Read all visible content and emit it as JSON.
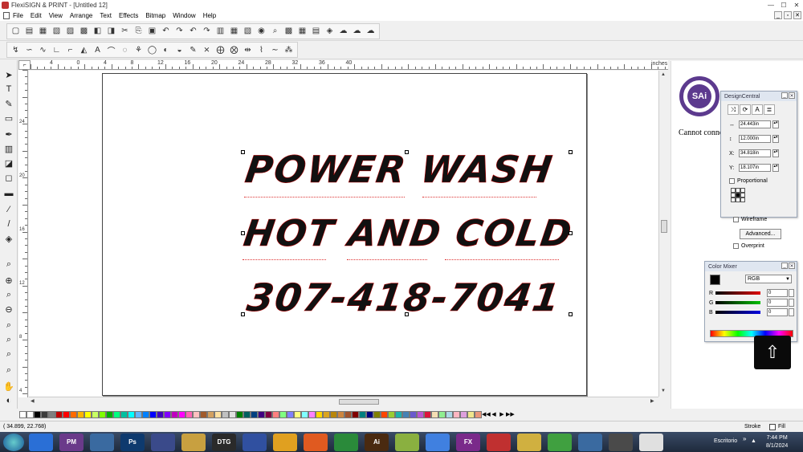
{
  "window": {
    "title": "FlexiSIGN & PRINT - [Untitled 12]"
  },
  "menu": [
    "File",
    "Edit",
    "View",
    "Arrange",
    "Text",
    "Effects",
    "Bitmap",
    "Window",
    "Help"
  ],
  "toolbar1_icons": [
    "new-icon",
    "open-icon",
    "save-icon",
    "save-as-icon",
    "print-icon",
    "import-icon",
    "export-icon",
    "tool-icon",
    "cut-icon",
    "copy-icon",
    "paste-icon",
    "undo-icon",
    "redo-icon",
    "undo2-icon",
    "redo2-icon",
    "doc-setup-icon",
    "group-icon",
    "ungroup-icon",
    "color-icon",
    "zoom-icon",
    "palette-icon",
    "rgb-icon",
    "output-icon",
    "rainbow-icon",
    "cloud-icon",
    "cloud-up-icon",
    "cloud-down-icon"
  ],
  "toolbar2_icons": [
    "path-icon",
    "curve-icon",
    "wave-icon",
    "line-icon",
    "corner-icon",
    "shape-icon",
    "text-path-icon",
    "arc-icon",
    "node-icon",
    "weld-icon",
    "outline-icon",
    "shadow-icon",
    "fill-icon",
    "pen-icon",
    "break-icon",
    "merge-icon",
    "split-icon",
    "mirror-icon",
    "distort-icon",
    "smooth-icon",
    "pattern-icon"
  ],
  "ruler": {
    "unit": "inches",
    "h_labels": [
      "4",
      "0",
      "4",
      "8",
      "12",
      "16",
      "20",
      "24",
      "28",
      "32",
      "36",
      "40"
    ],
    "v_labels": [
      "24",
      "20",
      "16",
      "12",
      "8",
      "4",
      "0"
    ]
  },
  "sign": {
    "line1": "POWER WASH",
    "line2": "HOT AND COLD",
    "line3": "307-418-7041"
  },
  "right_panel": {
    "logo_text": "SAi",
    "message": "Cannot connect"
  },
  "design_central": {
    "title": "DesignCentral",
    "width_label": "↔",
    "width_value": "24.443in",
    "height_label": "↕",
    "height_value": "12.000in",
    "x_label": "X:",
    "x_value": "34.818in",
    "y_label": "Y:",
    "y_value": "18.107in",
    "proportional_label": "Proportional",
    "wireframe_label": "Wireframe",
    "advanced_label": "Advanced...",
    "overprint_label": "Overprint"
  },
  "color_mixer": {
    "title": "Color Mixer",
    "model": "RGB",
    "r_label": "R",
    "r_value": "0",
    "g_label": "G",
    "g_value": "0",
    "b_label": "B",
    "b_value": "0"
  },
  "palette_colors": [
    "#ffffff",
    "#000000",
    "#3c3c3c",
    "#7f7f7f",
    "#c00000",
    "#ff0000",
    "#ff6a00",
    "#ffb400",
    "#ffff00",
    "#c8ff64",
    "#80ff00",
    "#00b000",
    "#00ff80",
    "#00c0a0",
    "#00ffff",
    "#64b4ff",
    "#0080ff",
    "#0000ff",
    "#4000c0",
    "#8000ff",
    "#c000c0",
    "#ff00ff",
    "#ff64b4",
    "#ffc0c0",
    "#a05a2c",
    "#d2a060",
    "#ffe0a0",
    "#c0c0c0",
    "#e0e0e0",
    "#008000",
    "#006060",
    "#004080",
    "#400080",
    "#800040",
    "#ff8080",
    "#80ff80",
    "#8080ff",
    "#ffff80",
    "#80ffff",
    "#ff80ff",
    "#ffd700",
    "#daa520",
    "#b8860b",
    "#cd853f",
    "#a0522d",
    "#800000",
    "#008080",
    "#000080",
    "#808000",
    "#ff4500",
    "#9acd32",
    "#20b2aa",
    "#4682b4",
    "#6a5acd",
    "#ba55d3",
    "#dc143c",
    "#f5deb3",
    "#90ee90",
    "#add8e6",
    "#ffb6c1",
    "#dda0dd",
    "#f0e68c",
    "#e9967a"
  ],
  "status": {
    "coords": "( 34.899,   22.768)",
    "stroke_label": "Stroke",
    "fill_label": "Fill"
  },
  "taskbar": {
    "apps": [
      "",
      "PM",
      "",
      "Ps",
      "",
      "",
      "DTG",
      "",
      "",
      "",
      "",
      "Ai",
      "",
      "",
      "FX",
      "",
      "",
      "",
      "",
      "",
      ""
    ],
    "tray_label": "Escritorio",
    "time": "7:44 PM",
    "date": "8/1/2024"
  }
}
